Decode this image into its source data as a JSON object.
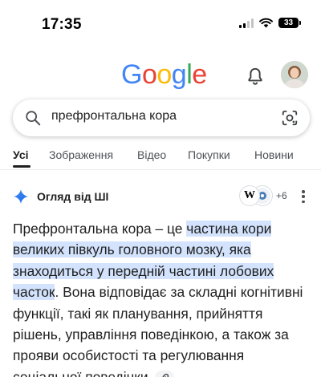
{
  "status_bar": {
    "time": "17:35",
    "battery": "33"
  },
  "header": {
    "logo_letters": [
      "G",
      "o",
      "o",
      "g",
      "l",
      "e"
    ],
    "logo_colors": [
      "#4285f4",
      "#ea4335",
      "#fbbc05",
      "#4285f4",
      "#34a853",
      "#ea4335"
    ]
  },
  "search": {
    "query": "префронтальна кора"
  },
  "tabs": [
    {
      "label": "Усі",
      "active": true
    },
    {
      "label": "Зображення",
      "active": false
    },
    {
      "label": "Відео",
      "active": false
    },
    {
      "label": "Покупки",
      "active": false
    },
    {
      "label": "Новини",
      "active": false
    }
  ],
  "ai_overview": {
    "title": "Огляд від ШІ",
    "source_count": "+6",
    "text_part1": "Префронтальна кора – це ",
    "text_highlight": "частина кори великих півкуль головного мозку, яка знаходиться у передній частині лобових часток",
    "text_part2": ". Вона відповідає за складні когнітивні функції, такі як планування, прийняття рішень, управління поведінкою, а також за прояви особистості та регулювання соціальної поведінки."
  },
  "colors": {
    "accent_blue": "#4285f4",
    "highlight": "#d3e3fd"
  }
}
